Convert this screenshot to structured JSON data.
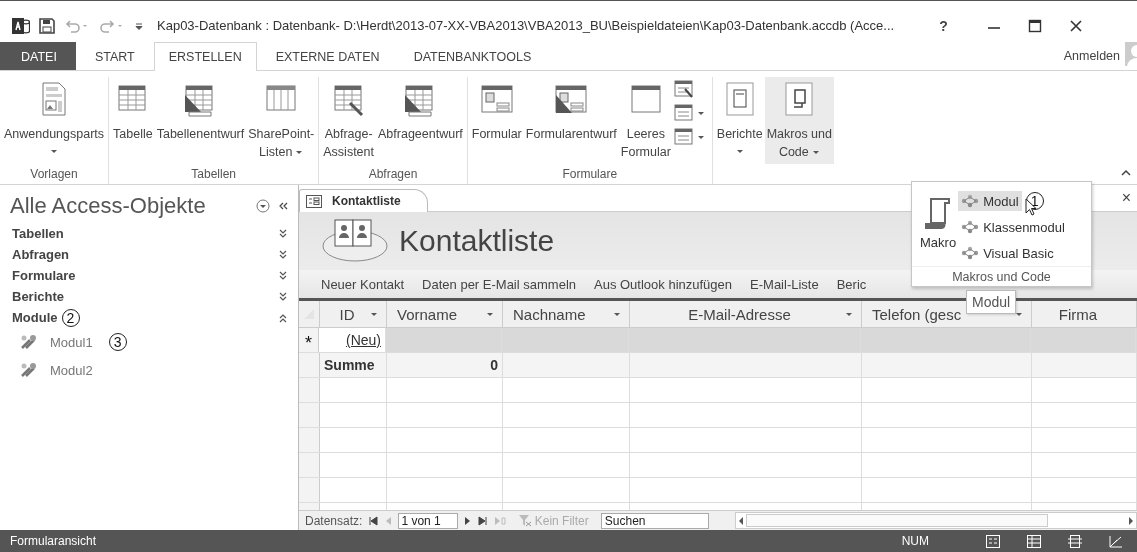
{
  "title_bar": {
    "title": "Kap03-Datenbank : Datenbank- D:\\Herdt\\2013-07-XX-VBA2013\\VBA2013_BU\\Beispieldateien\\Kap03-Datenbank.accdb (Acce...",
    "help": "?"
  },
  "tabs": [
    {
      "label": "DATEI",
      "kind": "file",
      "selected": false
    },
    {
      "label": "START",
      "kind": "tab",
      "selected": false
    },
    {
      "label": "ERSTELLEN",
      "kind": "tab",
      "selected": true
    },
    {
      "label": "EXTERNE DATEN",
      "kind": "tab",
      "selected": false
    },
    {
      "label": "DATENBANKTOOLS",
      "kind": "tab",
      "selected": false
    }
  ],
  "account": {
    "label": "Anmelden"
  },
  "ribbon_groups": [
    {
      "label": "Vorlagen",
      "buttons": [
        {
          "label": "Anwendungsparts",
          "kind": "large",
          "dropdown": true,
          "selected": false
        }
      ]
    },
    {
      "label": "Tabellen",
      "buttons": [
        {
          "label": "Tabelle",
          "kind": "large",
          "dropdown": false,
          "selected": false
        },
        {
          "label": "Tabellenentwurf",
          "kind": "large",
          "dropdown": false,
          "selected": false
        },
        {
          "label": "SharePoint-\nListen",
          "kind": "large",
          "dropdown": true,
          "selected": false
        }
      ]
    },
    {
      "label": "Abfragen",
      "buttons": [
        {
          "label": "Abfrage-\nAssistent",
          "kind": "large",
          "dropdown": false,
          "selected": false
        },
        {
          "label": "Abfrageentwurf",
          "kind": "large",
          "dropdown": false,
          "selected": false
        }
      ]
    },
    {
      "label": "Formulare",
      "buttons": [
        {
          "label": "Formular",
          "kind": "large",
          "dropdown": false,
          "selected": false
        },
        {
          "label": "Formularentwurf",
          "kind": "large",
          "dropdown": false,
          "selected": false
        },
        {
          "label": "Leeres\nFormular",
          "kind": "large",
          "dropdown": false,
          "selected": false
        },
        {
          "kind": "small",
          "dropdown": false,
          "selected": false
        },
        {
          "kind": "small",
          "dropdown": true,
          "selected": false
        },
        {
          "kind": "small",
          "dropdown": true,
          "selected": false
        }
      ]
    },
    {
      "buttons": [
        {
          "label": "Berichte",
          "kind": "large",
          "dropdown": true,
          "selected": false
        },
        {
          "label": "Makros und\nCode",
          "kind": "large",
          "dropdown": true,
          "selected": true
        }
      ]
    }
  ],
  "nav_pane": {
    "title": "Alle Access-Objekte",
    "groups": [
      {
        "label": "Tabellen",
        "expanded": false
      },
      {
        "label": "Abfragen",
        "expanded": false
      },
      {
        "label": "Formulare",
        "expanded": false
      },
      {
        "label": "Berichte",
        "expanded": false
      },
      {
        "label": "Module",
        "expanded": true,
        "callout": "2",
        "children": [
          {
            "label": "Modul1",
            "callout": "3"
          },
          {
            "label": "Modul2"
          }
        ]
      }
    ]
  },
  "document": {
    "tab": {
      "label": "Kontaktliste"
    },
    "close": "×",
    "header_title": "Kontaktliste",
    "actions": [
      "Neuer Kontakt",
      "Daten per E-Mail sammeln",
      "Aus Outlook hinzufügen",
      "E-Mail-Liste",
      "Beric"
    ],
    "datasheet": {
      "columns": [
        {
          "label": "ID",
          "dropdown": true
        },
        {
          "label": "Vorname",
          "dropdown": true
        },
        {
          "label": "Nachname",
          "dropdown": true
        },
        {
          "label": "E-Mail-Adresse",
          "dropdown": true
        },
        {
          "label": "Telefon (gesc",
          "dropdown": true
        },
        {
          "label": "Firma",
          "dropdown": false
        }
      ],
      "rows": [
        {
          "kind": "new",
          "selector": "*",
          "id": "(Neu)"
        },
        {
          "kind": "total",
          "label": "Summe",
          "total": "0"
        }
      ]
    },
    "record_nav": {
      "label": "Datensatz:",
      "position": "1 von 1",
      "filter": {
        "label": "Kein Filter",
        "disabled": true
      },
      "search": {
        "placeholder": "Suchen"
      }
    }
  },
  "popup": {
    "big": {
      "label": "Makro"
    },
    "items": [
      {
        "label": "Modul",
        "selected": true,
        "callout": "1"
      },
      {
        "label": "Klassenmodul",
        "selected": false
      },
      {
        "label": "Visual Basic",
        "selected": false
      }
    ],
    "footer": "Makros und Code"
  },
  "tooltip": "Modul",
  "status_bar": {
    "text": "Formularansicht",
    "num": "NUM"
  }
}
